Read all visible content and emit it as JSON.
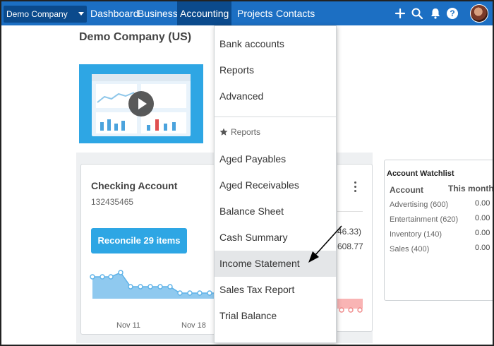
{
  "nav": {
    "org": "Demo Company (US)",
    "links": [
      "Dashboard",
      "Business",
      "Accounting",
      "Projects",
      "Contacts"
    ],
    "active": "Accounting",
    "icons": [
      "plus-icon",
      "search-icon",
      "bell-icon",
      "help-icon"
    ]
  },
  "page": {
    "title": "Demo Company (US)"
  },
  "dropdown": {
    "top_items": [
      "Bank accounts",
      "Reports",
      "Advanced"
    ],
    "section_label": "Reports",
    "report_items": [
      "Aged Payables",
      "Aged Receivables",
      "Balance Sheet",
      "Cash Summary",
      "Income Statement",
      "Sales Tax Report",
      "Trial Balance"
    ],
    "highlighted": "Income Statement"
  },
  "checking": {
    "title": "Checking Account",
    "number": "132435465",
    "reconcile_label": "Reconcile 29 items",
    "x_ticks": [
      "Nov 11",
      "Nov 18"
    ]
  },
  "middle_card": {
    "value1": "46.33)",
    "value2": "608.77"
  },
  "watchlist": {
    "title": "Account Watchlist",
    "col_account": "Account",
    "col_month": "This month",
    "rows": [
      {
        "name": "Advertising (600)",
        "value": "0.00"
      },
      {
        "name": "Entertainment (620)",
        "value": "0.00"
      },
      {
        "name": "Inventory (140)",
        "value": "0.00"
      },
      {
        "name": "Sales (400)",
        "value": "0.00"
      }
    ]
  },
  "colors": {
    "nav_bg": "#1c6fc3",
    "nav_active": "#0b4a8c",
    "accent": "#2ea6e4"
  }
}
